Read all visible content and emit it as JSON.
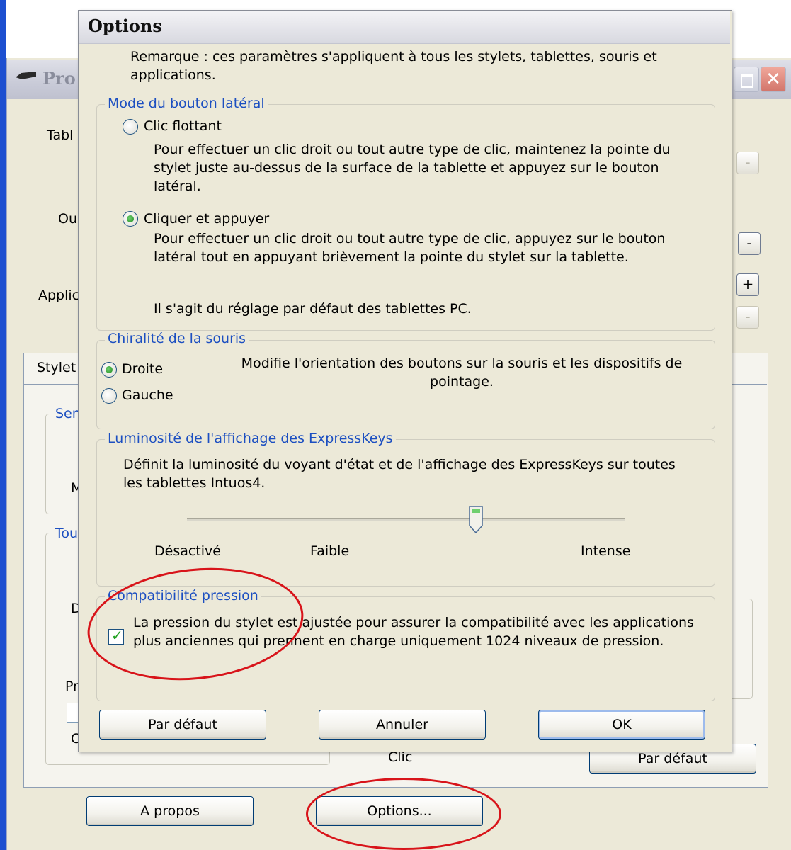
{
  "background_window": {
    "title_fragment": "Pro",
    "close_glyph": "✕",
    "labels": {
      "tablette": "Tabl",
      "outil": "Ou",
      "application": "Applic",
      "stylet_tab": "Stylet",
      "group_sen": "Sen",
      "group_tou": "Tou",
      "mid_m": "M",
      "mid_d": "D",
      "mid_p": "Pr",
      "mid_c": "C",
      "clic_fragment": "Clic"
    },
    "small_buttons": {
      "remove_top": "-",
      "remove_mid": "-",
      "add": "+",
      "remove_low": "-"
    },
    "buttons": {
      "par_defaut": "Par défaut",
      "a_propos": "A propos",
      "options": "Options..."
    }
  },
  "dialog": {
    "title": "Options",
    "note": "Remarque : ces paramètres s'appliquent à tous les stylets, tablettes, souris et applications.",
    "side_button_mode": {
      "legend": "Mode du bouton latéral",
      "option1_label": "Clic flottant",
      "option1_desc": "Pour effectuer un clic droit ou tout autre type de clic, maintenez la pointe du stylet juste au-dessus de la surface de la tablette et appuyez sur le bouton latéral.",
      "option2_label": "Cliquer et appuyer",
      "option2_desc": "Pour effectuer un clic droit ou tout autre type de clic, appuyez sur le bouton latéral tout en appuyant brièvement la pointe du stylet sur la tablette.",
      "default_note": "Il s'agit du réglage par défaut des tablettes PC.",
      "selected": "option2"
    },
    "handedness": {
      "legend": "Chiralité de la souris",
      "right_label": "Droite",
      "left_label": "Gauche",
      "description": "Modifie l'orientation des boutons sur la souris et les dispositifs de pointage.",
      "selected": "right"
    },
    "expresskeys_brightness": {
      "legend": "Luminosité de l'affichage des ExpressKeys",
      "description": "Définit la luminosité du voyant d'état et de l'affichage des ExpressKeys sur toutes les tablettes Intuos4.",
      "labels": [
        "Désactivé",
        "Faible",
        "Intense"
      ],
      "value_fraction": 0.66
    },
    "pressure_compat": {
      "legend": "Compatibilité pression",
      "checkbox_label": "La pression du stylet est ajustée pour assurer la compatibilité avec les applications plus anciennes qui prennent en charge uniquement 1024 niveaux de pression.",
      "checked": true
    },
    "buttons": {
      "default": "Par défaut",
      "cancel": "Annuler",
      "ok": "OK"
    }
  },
  "annotations": {
    "ellipse_color": "#d8141a"
  },
  "colors": {
    "legend_blue": "#1c4fc1",
    "dialog_bg": "#ece9d8",
    "xp_blue": "#1d4fd0"
  }
}
